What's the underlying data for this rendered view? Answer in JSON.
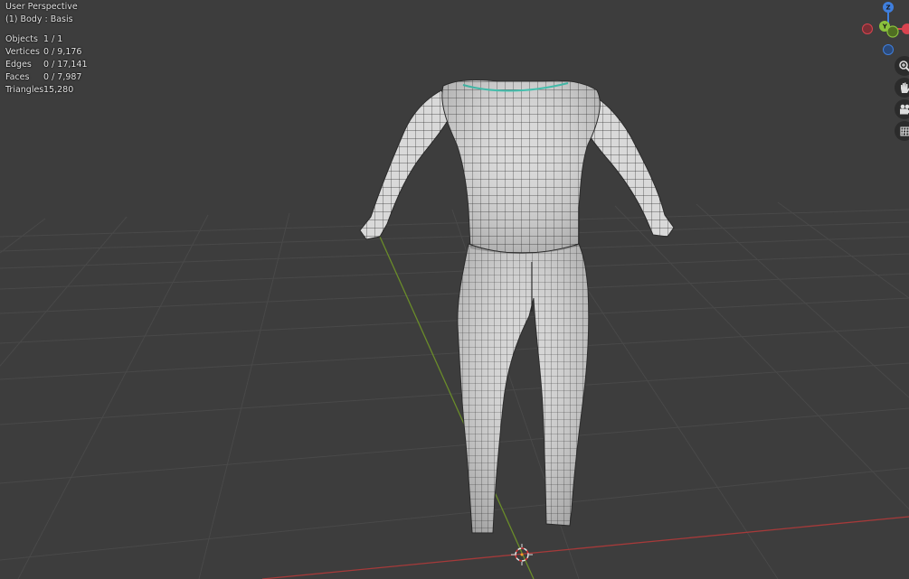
{
  "viewport": {
    "view_name": "User Perspective",
    "object_name": "(1) Body : Basis"
  },
  "stats": [
    {
      "label": "Objects",
      "value": "1 / 1"
    },
    {
      "label": "Vertices",
      "value": "0 / 9,176"
    },
    {
      "label": "Edges",
      "value": "0 / 17,141"
    },
    {
      "label": "Faces",
      "value": "0 / 7,987"
    },
    {
      "label": "Triangles",
      "value": "15,280"
    }
  ],
  "gizmo": {
    "z_label": "Z",
    "y_label": "Y",
    "x_color": "#d9434f",
    "y_color": "#8ac23c",
    "z_color": "#3f7fde"
  },
  "nav_icons": {
    "zoom": "zoom-icon",
    "pan": "hand-icon",
    "camera": "camera-icon",
    "ortho": "grid-icon"
  },
  "colors": {
    "background": "#3d3d3d",
    "grid_line": "#4a4a4a",
    "x_axis": "#a63a3a",
    "y_axis": "#6a8c2a",
    "mesh_fill": "#d7d7d7",
    "mesh_wire": "#2a2a2a",
    "selection": "#3ec9b5"
  }
}
